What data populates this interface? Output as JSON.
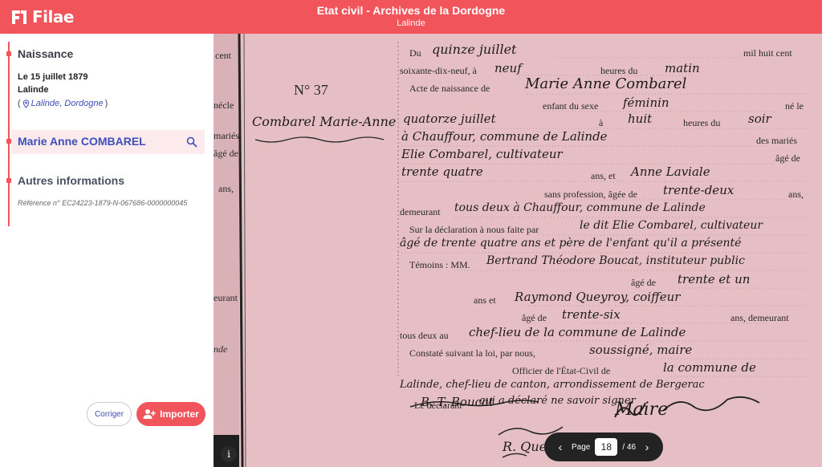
{
  "header": {
    "logo_text": "Filae",
    "title": "Etat civil - Archives de la Dordogne",
    "subtitle": "Lalinde"
  },
  "sidebar": {
    "naissance": {
      "title": "Naissance",
      "date": "Le 15 juillet 1879",
      "city": "Lalinde",
      "place_open": "(",
      "place_link": "Lalinde, Dordogne",
      "place_close": ")"
    },
    "person": {
      "name": "Marie Anne COMBAREL"
    },
    "autres": {
      "title": "Autres informations",
      "reference": "Référence n° EC24223-1879-N-067686-0000000045"
    },
    "buttons": {
      "corriger": "Corriger",
      "importer": "Importer"
    }
  },
  "document": {
    "left_margin": [
      "cent",
      "nécle",
      "mariés",
      "âgé de",
      "ans,",
      "eurant",
      "nde"
    ],
    "record_no": "N° 37",
    "margin_name": "Combarel Marie-Anne",
    "lines": [
      {
        "printed": "Du",
        "hand": "quinze juillet",
        "printed2": "mil huit cent"
      },
      {
        "printed": "soixante-dix-neuf, à",
        "hand": "neuf",
        "printed2": "heures du",
        "hand2": "matin"
      },
      {
        "printed": "Acte de naissance de",
        "hand": "Marie Anne Combarel"
      },
      {
        "printed": "enfant du sexe",
        "hand": "féminin",
        "printed2": "né le"
      },
      {
        "hand": "quatorze juillet",
        "printed": "à",
        "hand2": "huit",
        "printed2": "heures du",
        "hand3": "soir"
      },
      {
        "hand": "à Chauffour, commune de Lalinde",
        "printed": "des mariés"
      },
      {
        "hand": "Elie Combarel, cultivateur",
        "printed": "âgé de"
      },
      {
        "hand": "trente quatre",
        "printed": "ans, et",
        "hand2": "Anne Laviale"
      },
      {
        "printed": "sans profession, âgée de",
        "hand": "trente-deux",
        "printed2": "ans,"
      },
      {
        "printed": "demeurant",
        "hand": "tous deux à Chauffour, commune de Lalinde"
      },
      {
        "printed": "Sur la déclaration à nous faite par",
        "hand": "le dit Elie Combarel, cultivateur"
      },
      {
        "hand": "âgé de trente quatre ans et père de l'enfant qu'il a présenté"
      },
      {
        "printed": "Témoins : MM.",
        "hand": "Bertrand Théodore Boucat, instituteur public"
      },
      {
        "printed": "âgé de",
        "hand": "trente et un"
      },
      {
        "printed": "ans et",
        "hand": "Raymond Queyroy, coiffeur"
      },
      {
        "printed": "âgé de",
        "hand": "trente-six",
        "printed2": "ans, demeurant"
      },
      {
        "printed": "tous deux au",
        "hand": "chef-lieu de la commune de Lalinde"
      },
      {
        "printed": "Constaté suivant la loi, par nous,",
        "hand": "soussigné, maire"
      },
      {
        "printed": "Officier de l'État-Civil de",
        "hand": "la commune de"
      },
      {
        "hand": "Lalinde, chef-lieu de canton, arrondissement de Bergerac"
      },
      {
        "printed": "Le déclarant",
        "hand": "qui a déclaré ne savoir signer"
      }
    ],
    "signatures": [
      "B. T. Boucat",
      "R. Queyroy",
      "Maire"
    ]
  },
  "pager": {
    "label": "Page",
    "current": "18",
    "total": "/ 46",
    "prev": "‹",
    "next": "›"
  },
  "colors": {
    "brand": "#f2545b",
    "link": "#3d4fb8",
    "highlight": "#fdeaec",
    "document_tint": "#e6bfc4"
  }
}
